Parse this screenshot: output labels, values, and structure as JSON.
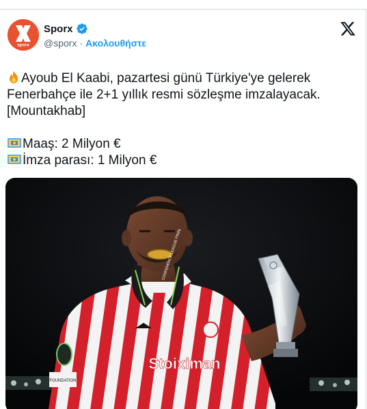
{
  "account": {
    "display_name": "Sporx",
    "handle": "@sporx",
    "separator": "·",
    "follow_label": "Ακολουθήστε",
    "avatar_text": "sporx",
    "avatar_color": "#e8522e"
  },
  "tweet": {
    "line1": "Ayoub El Kaabi, pazartesi günü Türkiye'ye gelerek",
    "line2": "Fenerbahçe ile 2+1 yıllık resmi sözleşme imzalayacak.",
    "line3": "[Mountakhab]",
    "salary": "Maaş: 2 Milyon €",
    "signing_fee": "İmza parası: 1 Milyon €"
  },
  "media": {
    "shirt_sponsor": "Stoiximan",
    "medal_ribbon_text": "CONFERENCE LEAGUE FINAL",
    "sleeve_badge_text": "FOUNDATION"
  },
  "icons": {
    "verified": "verified-badge-icon",
    "platform_logo": "x-logo-icon",
    "fire": "fire-emoji",
    "money": "banknote-emoji"
  },
  "colors": {
    "brand": "#e8522e",
    "link": "#1d9bf0",
    "text": "#0f1419",
    "muted": "#536471",
    "shirt_red": "#d4202a"
  }
}
